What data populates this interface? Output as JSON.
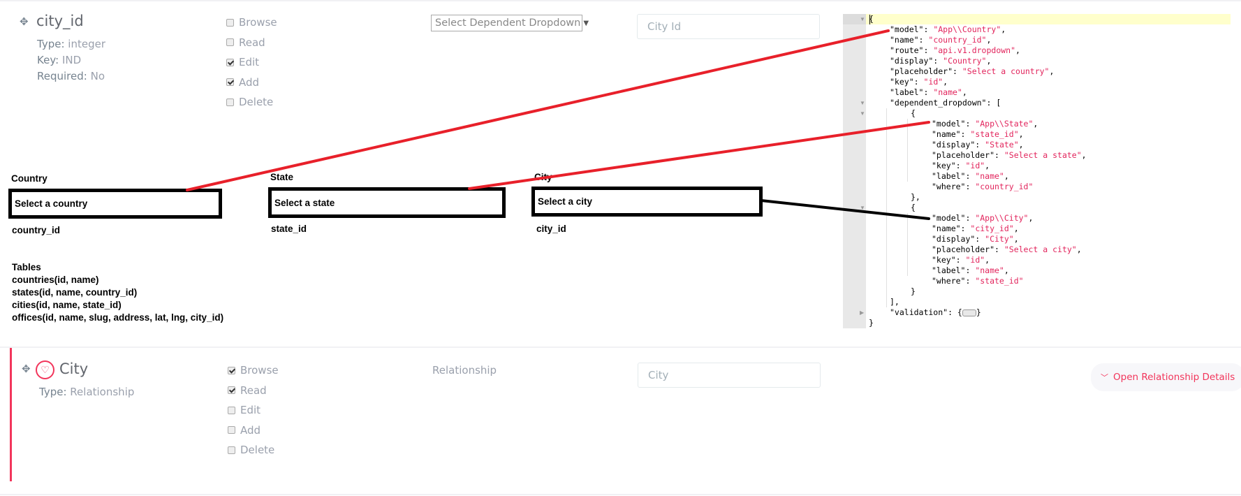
{
  "field1": {
    "name": "city_id",
    "type_label": "Type:",
    "type_value": "integer",
    "key_label": "Key:",
    "key_value": "IND",
    "required_label": "Required:",
    "required_value": "No",
    "permissions": [
      {
        "label": "Browse",
        "checked": false
      },
      {
        "label": "Read",
        "checked": false
      },
      {
        "label": "Edit",
        "checked": true
      },
      {
        "label": "Add",
        "checked": true
      },
      {
        "label": "Delete",
        "checked": false
      }
    ],
    "input_type_select": "Select Dependent Dropdown",
    "display_name_input": "City Id"
  },
  "code_editor": {
    "lines": [
      {
        "indent": 0,
        "tokens": [
          [
            "p",
            "{"
          ]
        ]
      },
      {
        "indent": 1,
        "tokens": [
          [
            "k",
            "\"model\": "
          ],
          [
            "s",
            "\"App\\\\Country\""
          ],
          [
            "p",
            ","
          ]
        ]
      },
      {
        "indent": 1,
        "tokens": [
          [
            "k",
            "\"name\": "
          ],
          [
            "s",
            "\"country_id\""
          ],
          [
            "p",
            ","
          ]
        ]
      },
      {
        "indent": 1,
        "tokens": [
          [
            "k",
            "\"route\": "
          ],
          [
            "s",
            "\"api.v1.dropdown\""
          ],
          [
            "p",
            ","
          ]
        ]
      },
      {
        "indent": 1,
        "tokens": [
          [
            "k",
            "\"display\": "
          ],
          [
            "s",
            "\"Country\""
          ],
          [
            "p",
            ","
          ]
        ]
      },
      {
        "indent": 1,
        "tokens": [
          [
            "k",
            "\"placeholder\": "
          ],
          [
            "s",
            "\"Select a country\""
          ],
          [
            "p",
            ","
          ]
        ]
      },
      {
        "indent": 1,
        "tokens": [
          [
            "k",
            "\"key\": "
          ],
          [
            "s",
            "\"id\""
          ],
          [
            "p",
            ","
          ]
        ]
      },
      {
        "indent": 1,
        "tokens": [
          [
            "k",
            "\"label\": "
          ],
          [
            "s",
            "\"name\""
          ],
          [
            "p",
            ","
          ]
        ]
      },
      {
        "indent": 1,
        "tokens": [
          [
            "k",
            "\"dependent_dropdown\": ["
          ]
        ]
      },
      {
        "indent": 2,
        "tokens": [
          [
            "p",
            "{"
          ]
        ]
      },
      {
        "indent": 3,
        "tokens": [
          [
            "k",
            "\"model\": "
          ],
          [
            "s",
            "\"App\\\\State\""
          ],
          [
            "p",
            ","
          ]
        ]
      },
      {
        "indent": 3,
        "tokens": [
          [
            "k",
            "\"name\": "
          ],
          [
            "s",
            "\"state_id\""
          ],
          [
            "p",
            ","
          ]
        ]
      },
      {
        "indent": 3,
        "tokens": [
          [
            "k",
            "\"display\": "
          ],
          [
            "s",
            "\"State\""
          ],
          [
            "p",
            ","
          ]
        ]
      },
      {
        "indent": 3,
        "tokens": [
          [
            "k",
            "\"placeholder\": "
          ],
          [
            "s",
            "\"Select a state\""
          ],
          [
            "p",
            ","
          ]
        ]
      },
      {
        "indent": 3,
        "tokens": [
          [
            "k",
            "\"key\": "
          ],
          [
            "s",
            "\"id\""
          ],
          [
            "p",
            ","
          ]
        ]
      },
      {
        "indent": 3,
        "tokens": [
          [
            "k",
            "\"label\": "
          ],
          [
            "s",
            "\"name\""
          ],
          [
            "p",
            ","
          ]
        ]
      },
      {
        "indent": 3,
        "tokens": [
          [
            "k",
            "\"where\": "
          ],
          [
            "s",
            "\"country_id\""
          ]
        ]
      },
      {
        "indent": 2,
        "tokens": [
          [
            "p",
            "},"
          ]
        ]
      },
      {
        "indent": 2,
        "tokens": [
          [
            "p",
            "{"
          ]
        ]
      },
      {
        "indent": 3,
        "tokens": [
          [
            "k",
            "\"model\": "
          ],
          [
            "s",
            "\"App\\\\City\""
          ],
          [
            "p",
            ","
          ]
        ]
      },
      {
        "indent": 3,
        "tokens": [
          [
            "k",
            "\"name\": "
          ],
          [
            "s",
            "\"city_id\""
          ],
          [
            "p",
            ","
          ]
        ]
      },
      {
        "indent": 3,
        "tokens": [
          [
            "k",
            "\"display\": "
          ],
          [
            "s",
            "\"City\""
          ],
          [
            "p",
            ","
          ]
        ]
      },
      {
        "indent": 3,
        "tokens": [
          [
            "k",
            "\"placeholder\": "
          ],
          [
            "s",
            "\"Select a city\""
          ],
          [
            "p",
            ","
          ]
        ]
      },
      {
        "indent": 3,
        "tokens": [
          [
            "k",
            "\"key\": "
          ],
          [
            "s",
            "\"id\""
          ],
          [
            "p",
            ","
          ]
        ]
      },
      {
        "indent": 3,
        "tokens": [
          [
            "k",
            "\"label\": "
          ],
          [
            "s",
            "\"name\""
          ],
          [
            "p",
            ","
          ]
        ]
      },
      {
        "indent": 3,
        "tokens": [
          [
            "k",
            "\"where\": "
          ],
          [
            "s",
            "\"state_id\""
          ]
        ]
      },
      {
        "indent": 2,
        "tokens": [
          [
            "p",
            "}"
          ]
        ]
      },
      {
        "indent": 1,
        "tokens": [
          [
            "p",
            "],"
          ]
        ]
      },
      {
        "indent": 1,
        "tokens": [
          [
            "k",
            "\"validation\": {"
          ],
          [
            "collapsed",
            ""
          ],
          [
            "p",
            "}"
          ]
        ]
      },
      {
        "indent": 0,
        "tokens": [
          [
            "p",
            "}"
          ]
        ]
      }
    ]
  },
  "diagram": {
    "country": {
      "label": "Country",
      "placeholder": "Select a country",
      "column": "country_id"
    },
    "state": {
      "label": "State",
      "placeholder": "Select a state",
      "column": "state_id"
    },
    "city": {
      "label": "City",
      "placeholder": "Select a city",
      "column": "city_id"
    },
    "tables_heading": "Tables",
    "tables": [
      "countries(id, name)",
      "states(id, name, country_id)",
      "cities(id, name, state_id)",
      "offices(id, name, slug, address, lat, lng, city_id)"
    ],
    "colors": {
      "red_connector": "#e8202a",
      "black_connector": "#000000"
    }
  },
  "field2": {
    "name": "City",
    "type_label": "Type:",
    "type_value": "Relationship",
    "permissions": [
      {
        "label": "Browse",
        "checked": true
      },
      {
        "label": "Read",
        "checked": true
      },
      {
        "label": "Edit",
        "checked": false
      },
      {
        "label": "Add",
        "checked": false
      },
      {
        "label": "Delete",
        "checked": false
      }
    ],
    "input_type_label": "Relationship",
    "display_name_input": "City",
    "open_details_label": "Open Relationship Details"
  },
  "colors": {
    "accent": "#f2355b",
    "text_muted": "#9aa0ac",
    "active_line": "#ffffcc"
  }
}
